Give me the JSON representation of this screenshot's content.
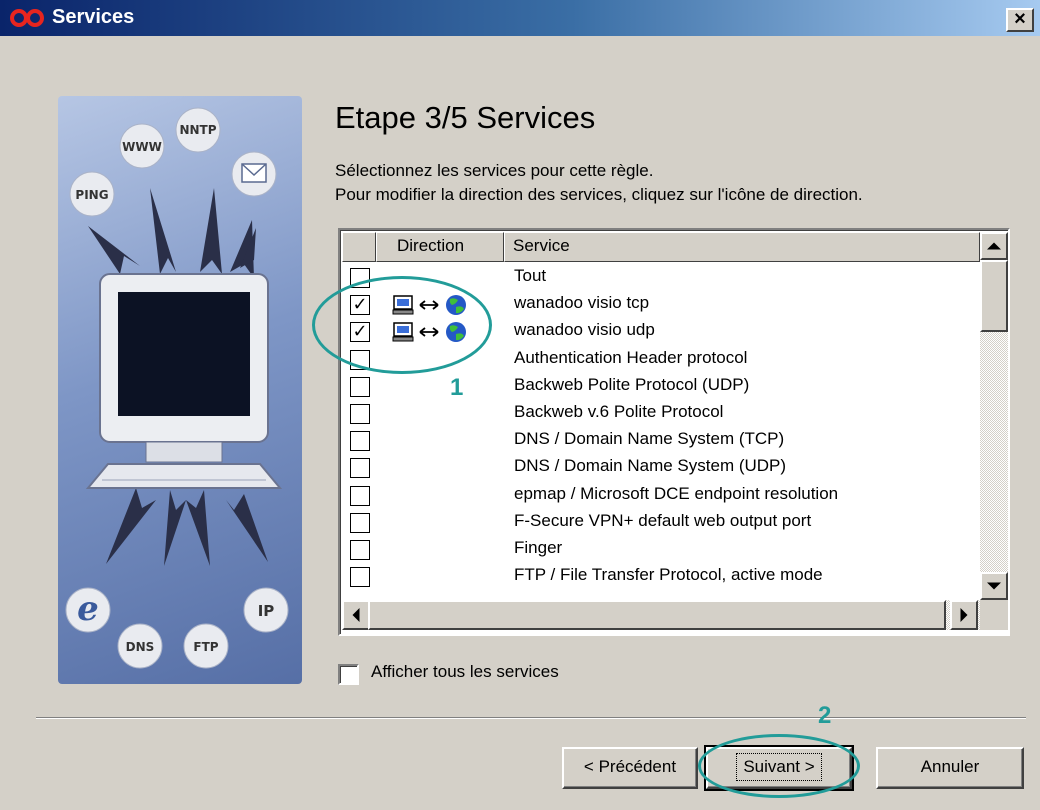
{
  "window": {
    "title": "Services",
    "close_label": "×"
  },
  "illustration": {
    "bubbles": [
      "WWW",
      "NNTP",
      "PING",
      "DNS",
      "FTP",
      "IP"
    ],
    "icons": [
      "mail-icon",
      "internet-explorer-icon",
      "monitor-icon"
    ]
  },
  "step": {
    "title": "Etape 3/5 Services",
    "line1": "Sélectionnez les services pour cette règle.",
    "line2": "Pour modifier la direction des services, cliquez sur l'icône de direction."
  },
  "list": {
    "columns": {
      "check": "",
      "direction": "Direction",
      "service": "Service"
    },
    "rows": [
      {
        "checked": false,
        "direction": "",
        "service": "Tout"
      },
      {
        "checked": true,
        "direction": "both",
        "service": "wanadoo visio tcp"
      },
      {
        "checked": true,
        "direction": "both",
        "service": "wanadoo visio udp"
      },
      {
        "checked": false,
        "direction": "",
        "service": "Authentication Header protocol"
      },
      {
        "checked": false,
        "direction": "",
        "service": "Backweb Polite Protocol (UDP)"
      },
      {
        "checked": false,
        "direction": "",
        "service": "Backweb v.6 Polite Protocol"
      },
      {
        "checked": false,
        "direction": "",
        "service": "DNS / Domain Name System (TCP)"
      },
      {
        "checked": false,
        "direction": "",
        "service": "DNS / Domain Name System (UDP)"
      },
      {
        "checked": false,
        "direction": "",
        "service": "epmap / Microsoft DCE endpoint resolution"
      },
      {
        "checked": false,
        "direction": "",
        "service": "F-Secure VPN+ default web output port"
      },
      {
        "checked": false,
        "direction": "",
        "service": "Finger"
      },
      {
        "checked": false,
        "direction": "",
        "service": "FTP / File Transfer Protocol, active mode"
      }
    ],
    "check_mark": "✓"
  },
  "show_all": {
    "label": "Afficher tous les services",
    "checked": false
  },
  "buttons": {
    "previous": "< Précédent",
    "next": "Suivant >",
    "cancel": "Annuler"
  },
  "annotations": {
    "one": "1",
    "two": "2"
  },
  "colors": {
    "title_start": "#0a246a",
    "title_end": "#a6caf0",
    "annotation": "#229c99",
    "face": "#d4d0c8"
  }
}
